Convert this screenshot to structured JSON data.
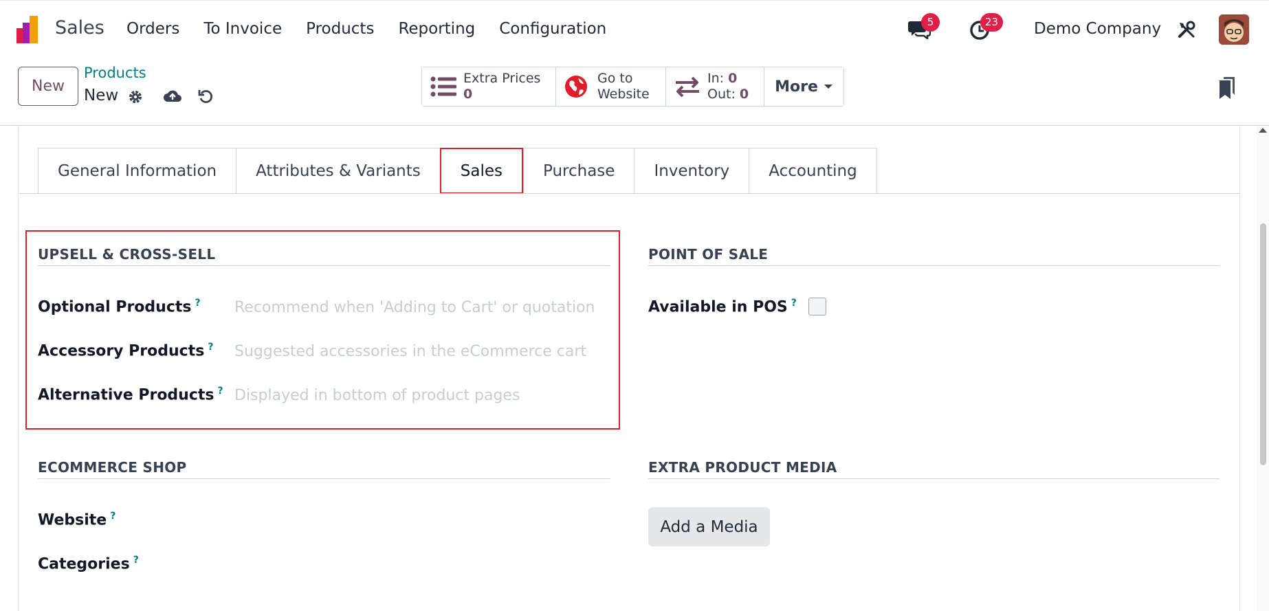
{
  "navbar": {
    "app_name": "Sales",
    "menu": [
      "Orders",
      "To Invoice",
      "Products",
      "Reporting",
      "Configuration"
    ],
    "messages_badge": "5",
    "activities_badge": "23",
    "company": "Demo Company",
    "icons": [
      "odoo-app-icon",
      "chat-icon",
      "clock-icon",
      "tools-icon",
      "avatar"
    ]
  },
  "control": {
    "new_label": "New",
    "breadcrumb_parent": "Products",
    "breadcrumb_current": "New",
    "smart_buttons": {
      "extra_prices_label": "Extra Prices",
      "extra_prices_value": "0",
      "website_line1": "Go to",
      "website_line2": "Website",
      "in_label": "In:",
      "in_value": "0",
      "out_label": "Out:",
      "out_value": "0",
      "more_label": "More"
    }
  },
  "tabs": [
    "General Information",
    "Attributes & Variants",
    "Sales",
    "Purchase",
    "Inventory",
    "Accounting"
  ],
  "active_tab": "Sales",
  "sections": {
    "upsell": {
      "title": "UPSELL & CROSS-SELL",
      "fields": [
        {
          "label": "Optional Products",
          "placeholder": "Recommend when 'Adding to Cart' or quotation"
        },
        {
          "label": "Accessory Products",
          "placeholder": "Suggested accessories in the eCommerce cart"
        },
        {
          "label": "Alternative Products",
          "placeholder": "Displayed in bottom of product pages"
        }
      ]
    },
    "pos": {
      "title": "POINT OF SALE",
      "available_label": "Available in POS"
    },
    "ecommerce": {
      "title": "ECOMMERCE SHOP",
      "website_label": "Website",
      "categories_label": "Categories"
    },
    "media": {
      "title": "EXTRA PRODUCT MEDIA",
      "add_label": "Add a Media"
    }
  },
  "help_mark": "?",
  "colors": {
    "primary": "#714b67",
    "link": "#017e84",
    "badge": "#e11d48",
    "highlight": "#e11d2a"
  }
}
